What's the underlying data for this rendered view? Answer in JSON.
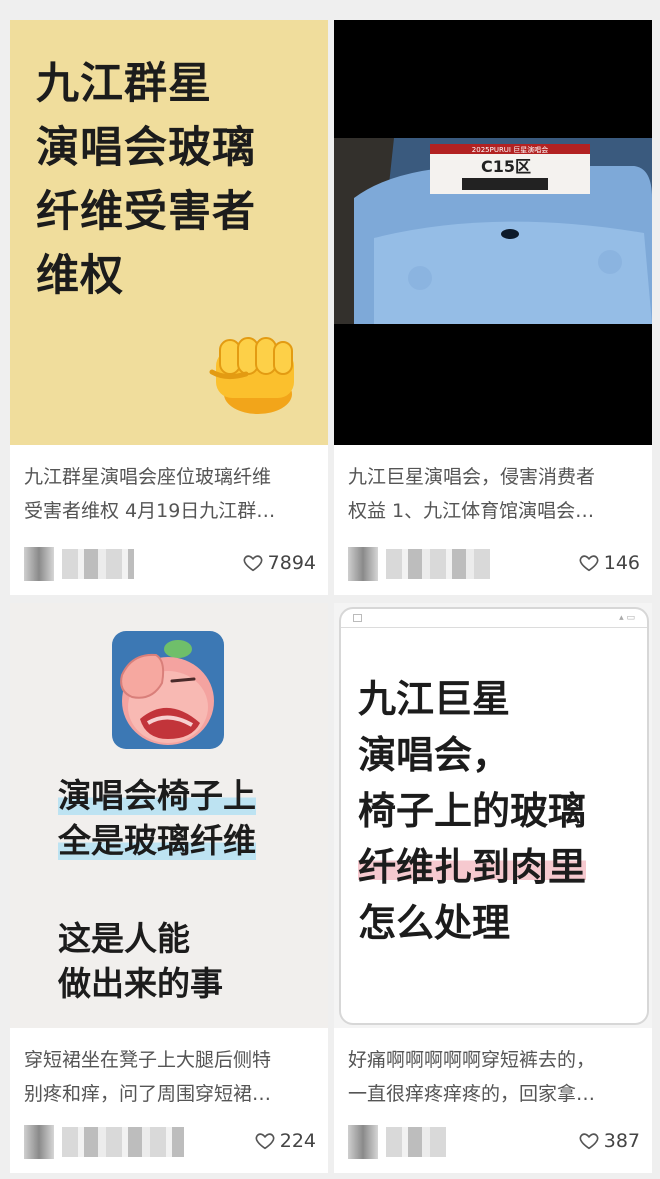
{
  "cards": [
    {
      "cover_lines": [
        "九江群星",
        "演唱会玻璃",
        "纤维受害者",
        "维权"
      ],
      "cover_icon": "fist-emoji",
      "desc_lines": [
        "九江群星演唱会座位玻璃纤维",
        "受害者维权 4月19日九江群…"
      ],
      "likes": "7894"
    },
    {
      "cover_sign": "C15区",
      "cover_banner": "2025PURUI 巨星演唱会",
      "desc_lines": [
        "九江巨星演唱会，侵害消费者",
        "权益 1、九江体育馆演唱会…"
      ],
      "likes": "146"
    },
    {
      "cover_lines": [
        "演唱会椅子上",
        "全是玻璃纤维",
        "这是人能",
        "做出来的事"
      ],
      "cover_icon": "facepalm-sticker",
      "desc_lines": [
        "穿短裙坐在凳子上大腿后侧特",
        "别疼和痒，问了周围穿短裙…"
      ],
      "likes": "224"
    },
    {
      "cover_lines": [
        "九江巨星",
        "演唱会，",
        "椅子上的玻璃",
        "纤维扎到肉里",
        "怎么处理"
      ],
      "desc_lines": [
        "好痛啊啊啊啊啊穿短裤去的，",
        "一直很痒疼痒疼的，回家拿…"
      ],
      "likes": "387"
    }
  ],
  "colors": {
    "card1_bg": "#f0dd9c",
    "card3_highlight": "#bde3f2",
    "card4_highlight": "#f6c9cf"
  }
}
